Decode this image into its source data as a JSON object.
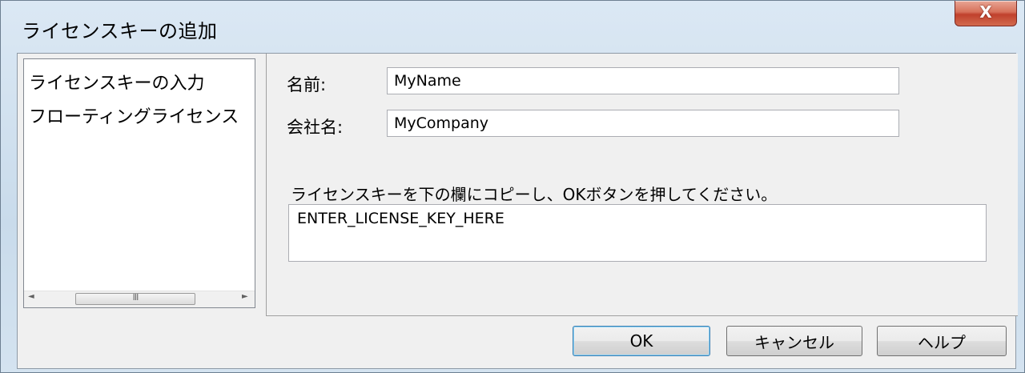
{
  "window": {
    "title": "ライセンスキーの追加",
    "close_glyph": "X"
  },
  "sidebar": {
    "items": [
      {
        "label": "ライセンスキーの入力"
      },
      {
        "label": "フローティングライセンス"
      }
    ],
    "scrollbar": {
      "left_arrow": "◄",
      "right_arrow": "►",
      "grip": "III"
    }
  },
  "form": {
    "name_label": "名前:",
    "name_value": "MyName",
    "company_label": "会社名:",
    "company_value": "MyCompany",
    "instruction": "ライセンスキーを下の欄にコピーし、OKボタンを押してください。",
    "license_value": "ENTER_LICENSE_KEY_HERE"
  },
  "buttons": {
    "ok": "OK",
    "cancel": "キャンセル",
    "help": "ヘルプ"
  }
}
